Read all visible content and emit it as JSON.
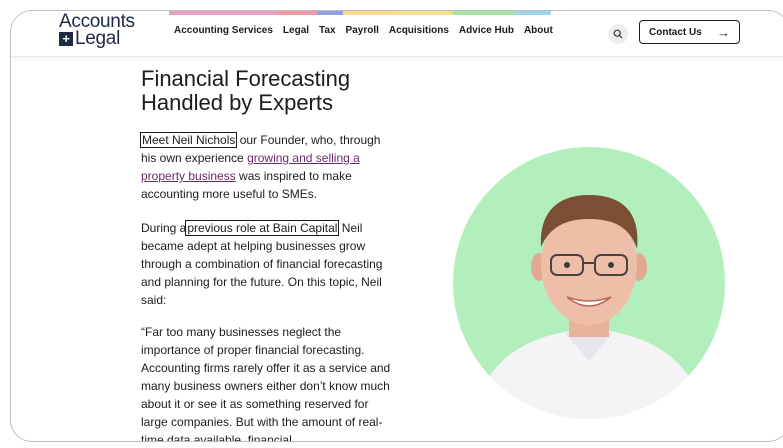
{
  "colors": {
    "brand": "#1f2a44",
    "link": "#6a2a66",
    "portrait_bg": "#b3efbd",
    "stripes": [
      "#e8a1c4",
      "#ef9aa6",
      "#8fa2e6",
      "#ffd98a",
      "#f4e08a",
      "#a8e3a4",
      "#9fd6e8"
    ]
  },
  "header": {
    "logo_line1": "Accounts",
    "logo_line2": "Legal",
    "logo_mark": "+",
    "nav": [
      "Accounting Services",
      "Legal",
      "Tax",
      "Payroll",
      "Acquisitions",
      "Advice Hub",
      "About"
    ],
    "search_icon": "search-icon",
    "contact_label": "Contact Us",
    "contact_arrow": "→"
  },
  "main": {
    "heading_line1": "Financial Forecasting",
    "heading_line2": "Handled by Experts",
    "p1": {
      "boxed": "Meet Neil Nichols",
      "text1": " our Founder, who, through his own experience ",
      "link": "growing and selling a property business",
      "text2": " was inspired to make accounting more useful to SMEs."
    },
    "p2": {
      "text1": "During a",
      "boxed": "previous role at Bain Capital",
      "text2": " Neil became adept at helping businesses grow through a combination of financial forecasting and planning for the future. On this topic, Neil said:"
    },
    "p3": "“Far too many businesses neglect the importance of proper financial forecasting. Accounting firms rarely offer it as a service and many business owners either don’t know much about it or see it as something reserved for large companies. But with the amount of real-time data available, financial"
  }
}
